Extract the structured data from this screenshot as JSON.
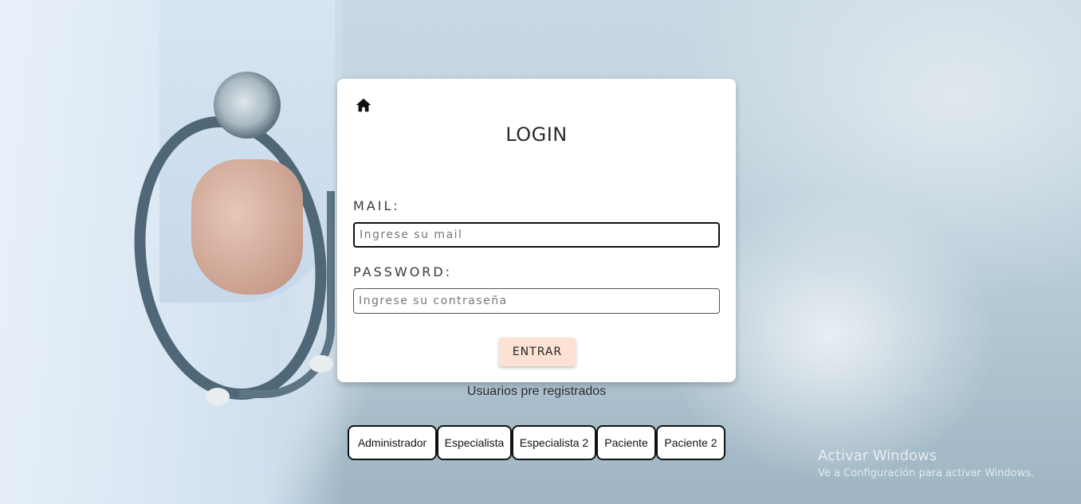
{
  "login": {
    "title": "LOGIN",
    "mail_label": "MAIL:",
    "mail_placeholder": "Ingrese su mail",
    "mail_value": "",
    "password_label": "PASSWORD:",
    "password_placeholder": "Ingrese su contraseña",
    "password_value": "",
    "submit_label": "ENTRAR",
    "home_icon": "home-icon"
  },
  "preregistered": {
    "heading": "Usuarios pre registrados",
    "users": [
      "Administrador",
      "Especialista",
      "Especialista 2",
      "Paciente",
      "Paciente 2"
    ]
  },
  "watermark": {
    "line1": "Activar Windows",
    "line2": "Ve a Configuración para activar Windows."
  },
  "colors": {
    "submit_bg": "#fde2d3",
    "card_bg": "#ffffff"
  }
}
